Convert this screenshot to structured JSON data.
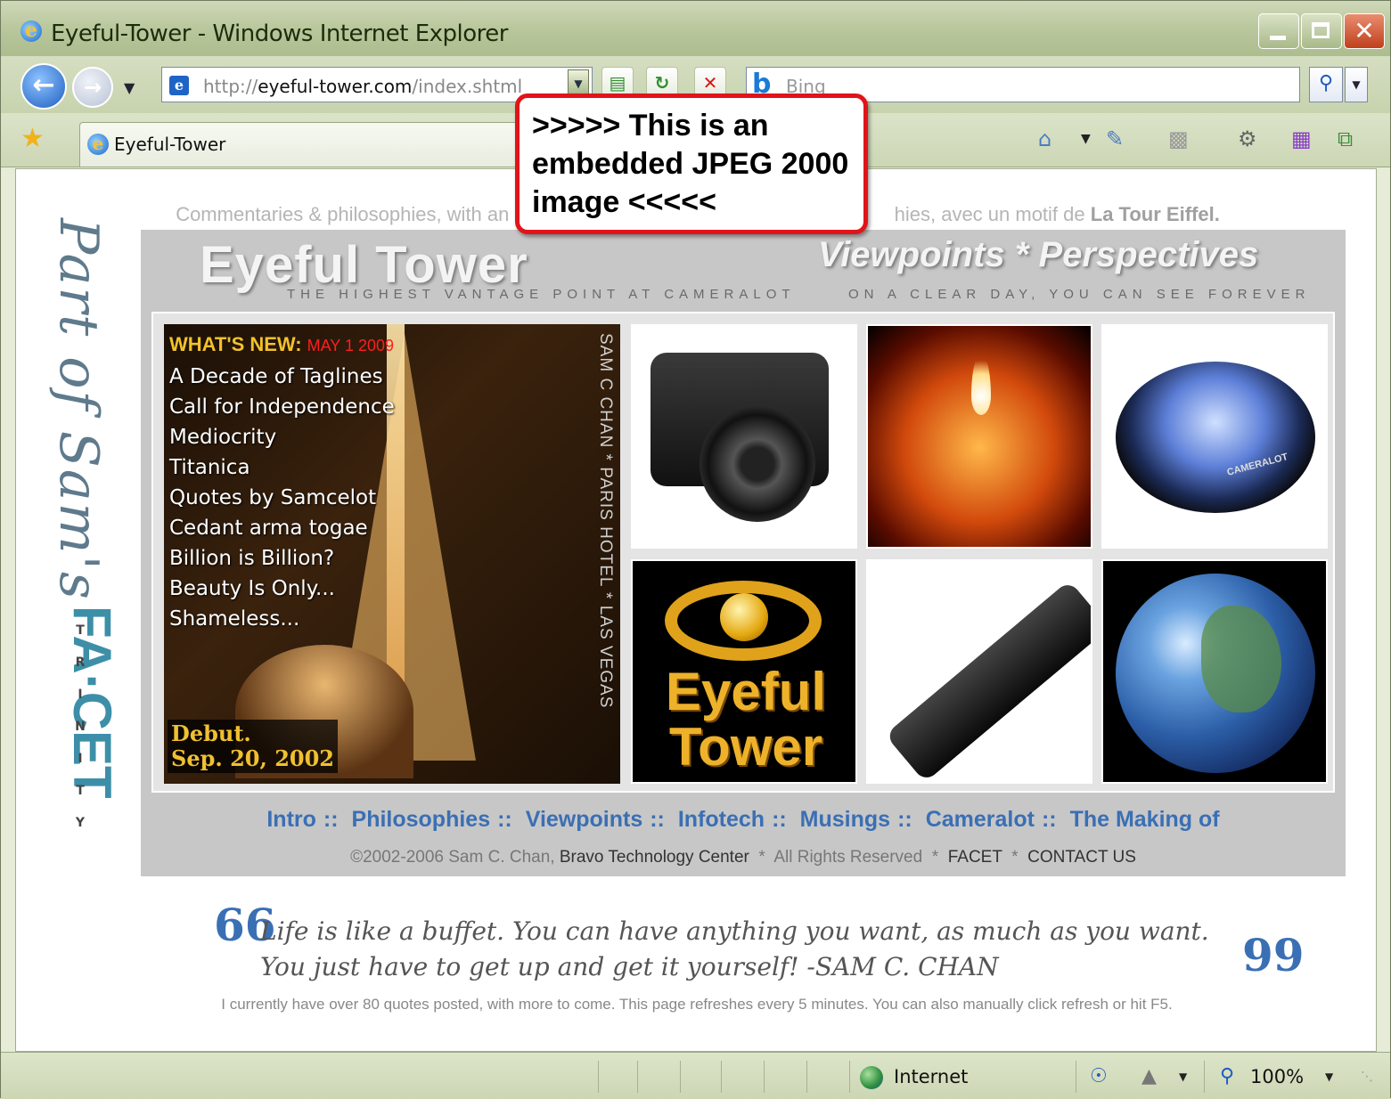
{
  "window": {
    "title": "Eyeful-Tower - Windows Internet Explorer",
    "close_glyph": "✕"
  },
  "nav": {
    "url_prefix": "http://",
    "url_domain": "eyeful-tower.com",
    "url_path": "/index.shtml",
    "search_placeholder": "Bing"
  },
  "tab": {
    "label": "Eyeful-Tower"
  },
  "callout": {
    "text": ">>>>> This is an embedded JPEG 2000 image <<<<<"
  },
  "page": {
    "tagline_left": "Commentaries & philosophies, with an",
    "tagline_right": "hies, avec un motif de",
    "tagline_bold": "La Tour Eiffel.",
    "signature": "Part of Sam's",
    "facet": "FA·CET",
    "trinity": [
      "T",
      "R",
      "I",
      "N",
      "I",
      "T",
      "Y"
    ],
    "brand_left": "Eyeful Tower",
    "brand_right": "Viewpoints * Perspectives",
    "sub_left": "THE HIGHEST VANTAGE POINT AT CAMERALOT",
    "sub_right": "ON A CLEAR DAY, YOU CAN SEE FOREVER",
    "whats_new_label": "WHAT'S NEW:",
    "whats_new_date": "MAY 1 2009",
    "news_items": [
      "A Decade of Taglines",
      "Call for Independence",
      "Mediocrity",
      "Titanica",
      "Quotes by Samcelot",
      "Cedant arma togae",
      "Billion is Billion?",
      "Beauty Is Only...",
      "Shameless..."
    ],
    "vertical_credit": "SAM C CHAN * PARIS HOTEL * LAS VEGAS",
    "debut_line1": "Debut.",
    "debut_line2": "Sep. 20, 2002",
    "lens_brand": "CAMERALOT",
    "logo_line1": "Eyeful",
    "logo_line2": "Tower",
    "nav_links": [
      "Intro",
      "Philosophies",
      "Viewpoints",
      "Infotech",
      "Musings",
      "Cameralot",
      "The Making of"
    ],
    "nav_separator": "::",
    "copyright_prefix": "©2002-2006 Sam C. Chan,",
    "copyright_org": "Bravo Technology Center",
    "copyright_rights": "All Rights Reserved",
    "copyright_facet": "FACET",
    "copyright_contact": "CONTACT US",
    "copyright_star": "*",
    "quote_open": "66",
    "quote_close": "99",
    "quote": "Life is like a buffet. You can have anything you want, as much as you want. You just have to get up and get it yourself! -SAM C. CHAN",
    "quote_note": "I currently have over 80 quotes posted, with more to come. This page refreshes every 5 minutes. You can also manually click refresh or hit F5."
  },
  "status": {
    "zone": "Internet",
    "zoom": "100%"
  }
}
